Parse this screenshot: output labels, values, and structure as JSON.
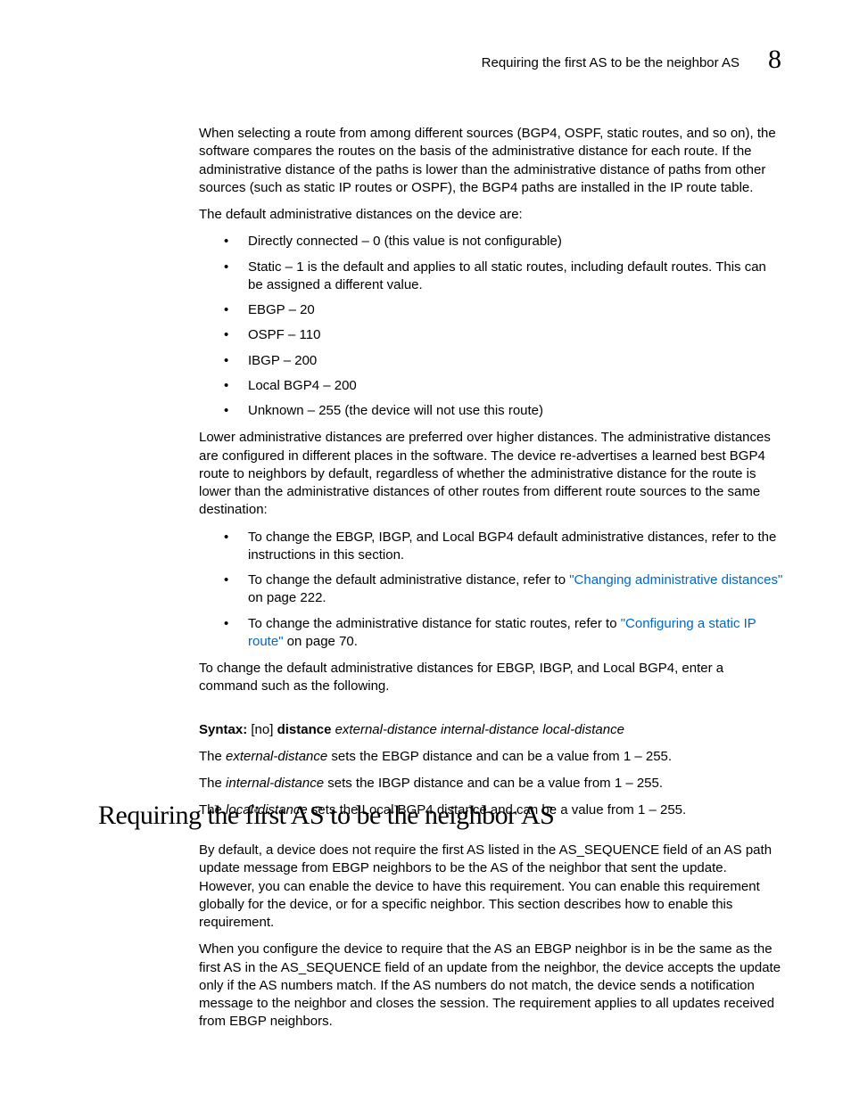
{
  "header": {
    "title": "Requiring the first AS to be the neighbor AS",
    "chapter": "8"
  },
  "p1": "When selecting a route from among different sources (BGP4, OSPF, static routes, and so on), the software compares the routes on the basis of the administrative distance for each route. If the administrative distance of the paths is lower than the administrative distance of paths from other sources (such as static IP routes or OSPF), the BGP4 paths are installed in the IP route table.",
  "p2": "The default administrative distances on the device are:",
  "list1": {
    "i0": "Directly connected – 0 (this value is not configurable)",
    "i1": "Static – 1 is the default and applies to all static routes, including default routes. This can be assigned a different value.",
    "i2": "EBGP – 20",
    "i3": "OSPF – 110",
    "i4": "IBGP – 200",
    "i5": "Local BGP4 – 200",
    "i6": "Unknown – 255 (the device will not use this route)"
  },
  "p3": "Lower administrative distances are preferred over higher distances. The administrative distances are configured in different places in the software. The device re-advertises a learned best BGP4 route to neighbors by default, regardless of whether the administrative distance for the route is lower than the administrative distances of other routes from different route sources to the same destination:",
  "list2": {
    "i0": "To change the EBGP, IBGP, and Local BGP4 default administrative distances, refer to the instructions in this section.",
    "i1a": "To change the default administrative distance, refer to ",
    "i1link": "\"Changing administrative distances\"",
    "i1b": " on page 222.",
    "i2a": "To change the administrative distance for static routes, refer to ",
    "i2link": "\"Configuring a static IP route\"",
    "i2b": " on page 70."
  },
  "p4": "To change the default administrative distances for EBGP, IBGP, and Local BGP4, enter a command such as the following.",
  "syntax": {
    "label": "Syntax:",
    "no": "[no]",
    "cmd": "distance",
    "args": "external-distance internal-distance local-distance"
  },
  "p5a": "The ",
  "p5i": "external-distance",
  "p5b": " sets the EBGP distance and can be a value from 1 – 255.",
  "p6a": "The ",
  "p6i": "internal-distance",
  "p6b": " sets the IBGP distance and can be a value from 1 – 255.",
  "p7a": "The ",
  "p7i": "local-distance",
  "p7b": " sets the Local BGP4 distance and can be a value from 1 – 255.",
  "h1": "Requiring the first AS to be the neighbor AS",
  "s2p1": "By default, a device does not require the first AS listed in the AS_SEQUENCE field of an AS path update message from EBGP neighbors to be the AS of the neighbor that sent the update. However, you can enable the device to have this requirement. You can enable this requirement globally for the device, or for a specific neighbor. This section describes how to enable this requirement.",
  "s2p2": "When you configure the device to require that the AS an EBGP neighbor is in be the same as the first AS in the AS_SEQUENCE field of an update from the neighbor, the device accepts the update only if the AS numbers match. If the AS numbers do not match, the device sends a notification message to the neighbor and closes the session. The requirement applies to all updates received from EBGP neighbors."
}
